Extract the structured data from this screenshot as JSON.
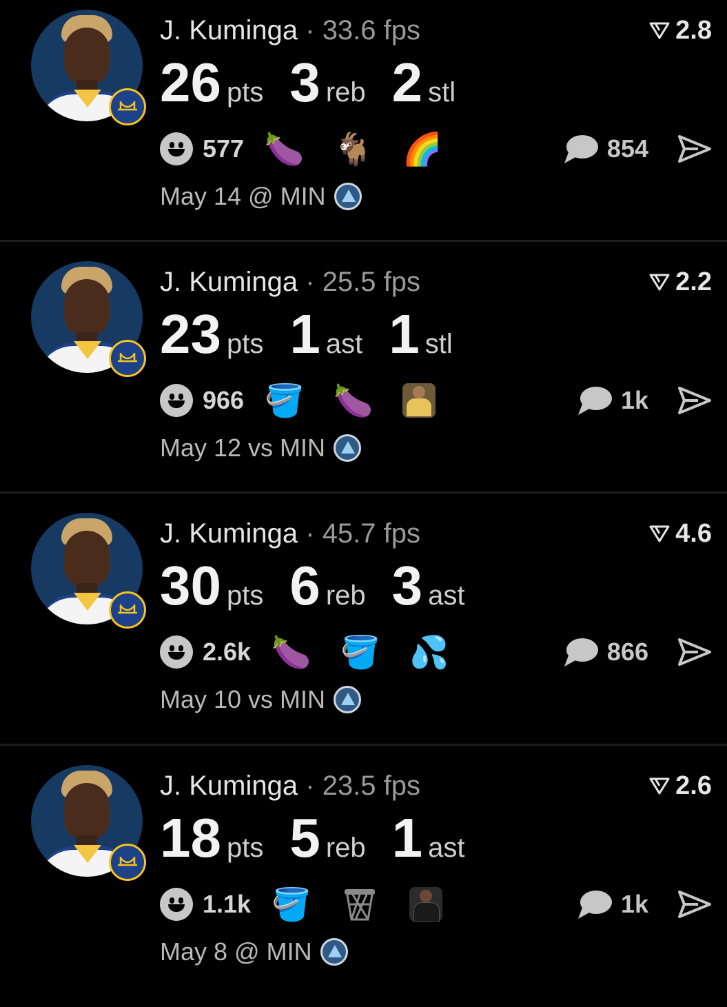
{
  "colors": {
    "background": "#000000",
    "accent_team_primary": "#1d428a",
    "accent_team_secondary": "#f9c41a"
  },
  "posts": [
    {
      "player": "J. Kuminga",
      "separator": "·",
      "fps": "33.6 fps",
      "rating": "2.8",
      "stats": [
        {
          "value": "26",
          "unit": "pts"
        },
        {
          "value": "3",
          "unit": "reb"
        },
        {
          "value": "2",
          "unit": "stl"
        }
      ],
      "reaction_count": "577",
      "reactions": [
        {
          "name": "eggplant-emoji",
          "glyph": "🍆"
        },
        {
          "name": "goat-emoji",
          "glyph": "🐐"
        },
        {
          "name": "rainbow-emoji",
          "glyph": "🌈"
        }
      ],
      "comment_count": "854",
      "date": "May 14 @ MIN"
    },
    {
      "player": "J. Kuminga",
      "separator": "·",
      "fps": "25.5 fps",
      "rating": "2.2",
      "stats": [
        {
          "value": "23",
          "unit": "pts"
        },
        {
          "value": "1",
          "unit": "ast"
        },
        {
          "value": "1",
          "unit": "stl"
        }
      ],
      "reaction_count": "966",
      "reactions": [
        {
          "name": "bucket-emoji",
          "glyph": "🪣"
        },
        {
          "name": "eggplant-emoji",
          "glyph": "🍆"
        },
        {
          "name": "player-sticker",
          "glyph": ""
        }
      ],
      "comment_count": "1k",
      "date": "May 12 vs MIN"
    },
    {
      "player": "J. Kuminga",
      "separator": "·",
      "fps": "45.7 fps",
      "rating": "4.6",
      "stats": [
        {
          "value": "30",
          "unit": "pts"
        },
        {
          "value": "6",
          "unit": "reb"
        },
        {
          "value": "3",
          "unit": "ast"
        }
      ],
      "reaction_count": "2.6k",
      "reactions": [
        {
          "name": "eggplant-emoji",
          "glyph": "🍆"
        },
        {
          "name": "bucket-emoji",
          "glyph": "🪣"
        },
        {
          "name": "sweat-droplets-emoji",
          "glyph": "💦"
        }
      ],
      "comment_count": "866",
      "date": "May 10 vs MIN"
    },
    {
      "player": "J. Kuminga",
      "separator": "·",
      "fps": "23.5 fps",
      "rating": "2.6",
      "stats": [
        {
          "value": "18",
          "unit": "pts"
        },
        {
          "value": "5",
          "unit": "reb"
        },
        {
          "value": "1",
          "unit": "ast"
        }
      ],
      "reaction_count": "1.1k",
      "reactions": [
        {
          "name": "bucket-emoji",
          "glyph": "🪣"
        },
        {
          "name": "basketball-net-emoji",
          "glyph": ""
        },
        {
          "name": "brooklyn-player-sticker",
          "glyph": ""
        }
      ],
      "comment_count": "1k",
      "date": "May 8 @ MIN"
    }
  ]
}
